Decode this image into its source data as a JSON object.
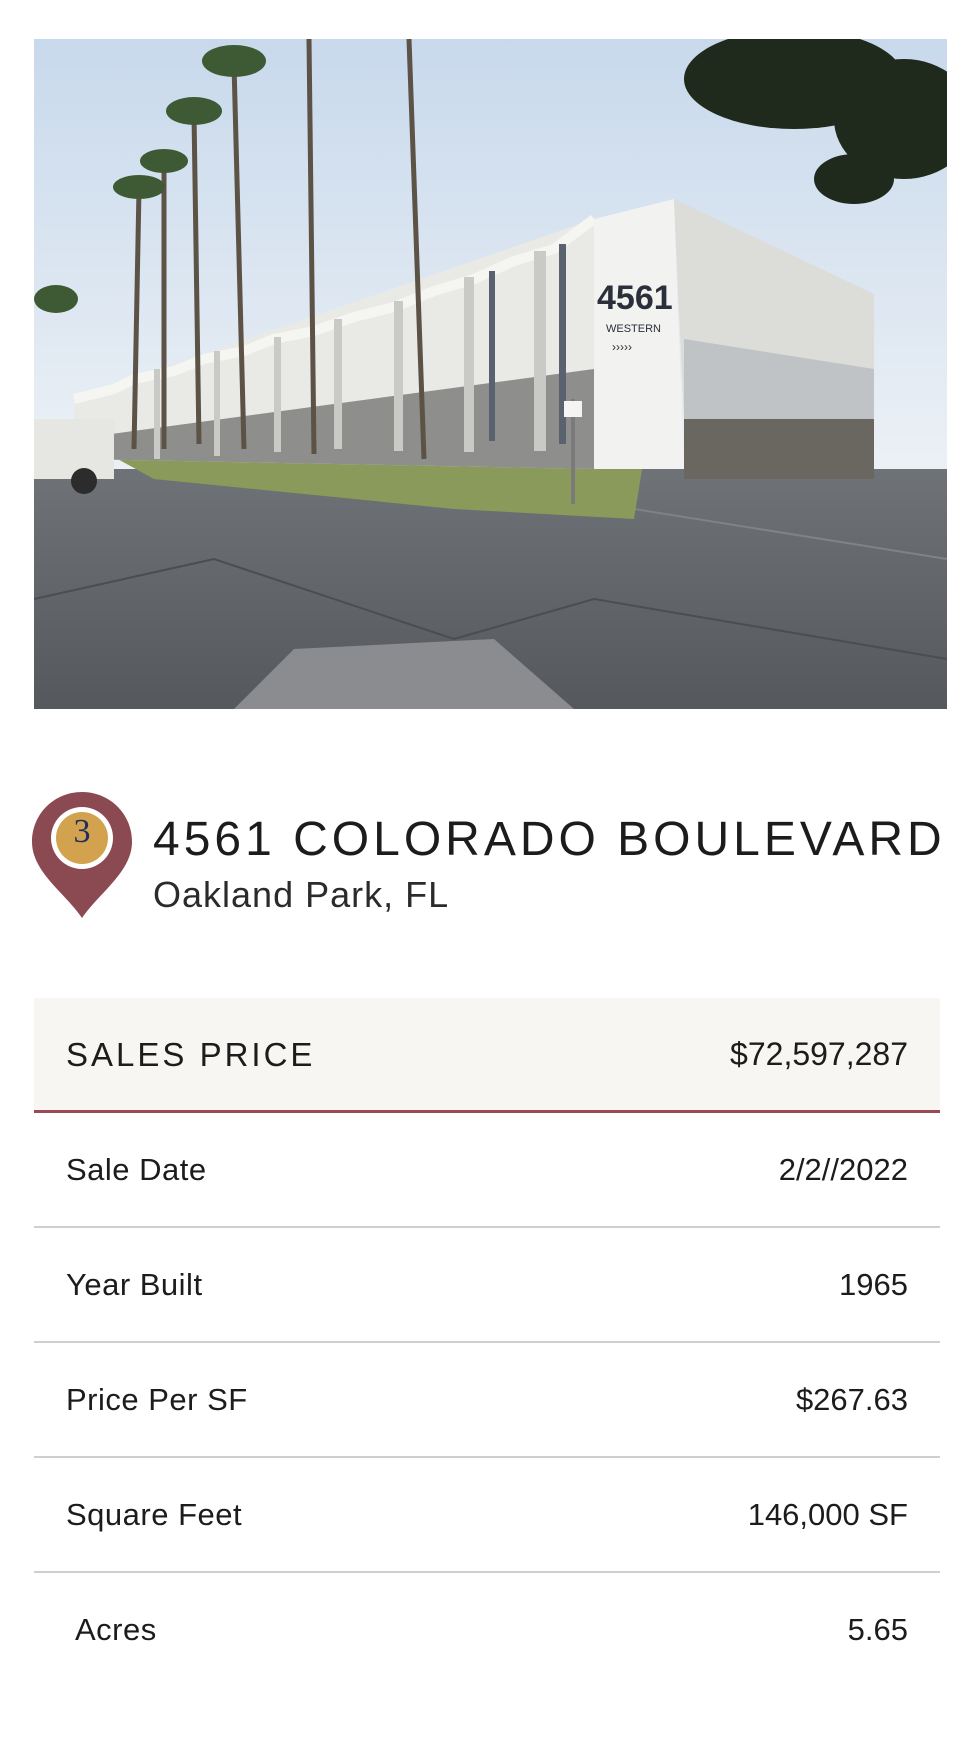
{
  "photo": {
    "sign_number": "4561",
    "sign_text": "WESTERN"
  },
  "property": {
    "marker_number": "3",
    "address": "4561 COLORADO BOULEVARD",
    "city": "Oakland Park, FL"
  },
  "details": {
    "header": {
      "label": "SALES PRICE",
      "value": "$72,597,287"
    },
    "rows": [
      {
        "label": "Sale Date",
        "value": "2/2//2022"
      },
      {
        "label": "Year Built",
        "value": "1965"
      },
      {
        "label": "Price Per SF",
        "value": "$267.63"
      },
      {
        "label": "Square Feet",
        "value": "146,000 SF"
      },
      {
        "label": "Acres",
        "value": "5.65"
      }
    ]
  },
  "colors": {
    "accent": "#9a4a52",
    "marker_gold": "#d2a24f",
    "header_bg": "#f8f6f3"
  }
}
